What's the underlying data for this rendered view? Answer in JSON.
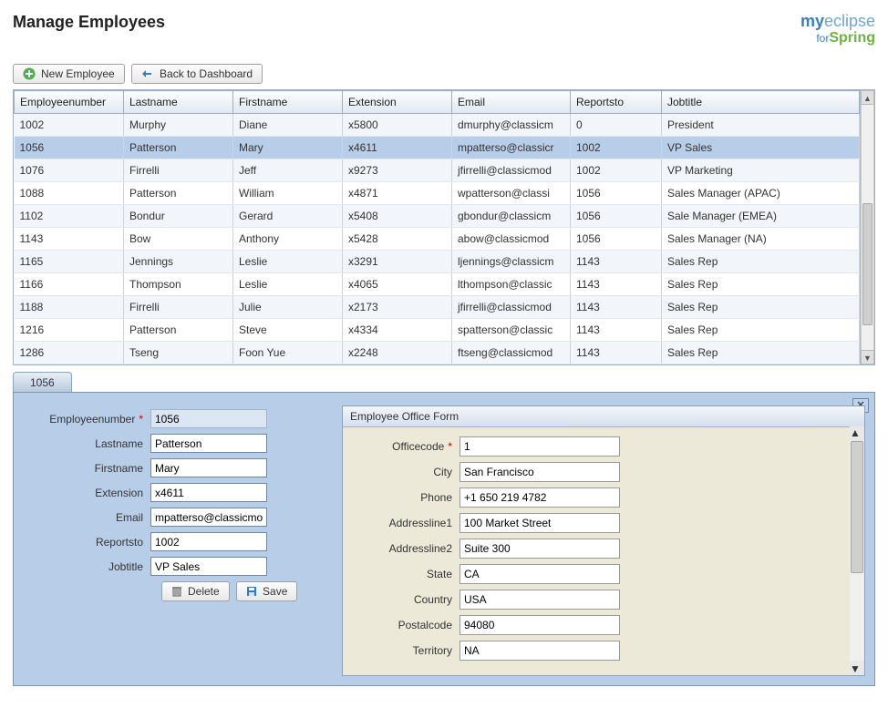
{
  "page": {
    "title": "Manage Employees"
  },
  "toolbar": {
    "new_label": "New Employee",
    "back_label": "Back to Dashboard"
  },
  "grid": {
    "columns": [
      "Employeenumber",
      "Lastname",
      "Firstname",
      "Extension",
      "Email",
      "Reportsto",
      "Jobtitle"
    ],
    "rows": [
      {
        "num": "1002",
        "last": "Murphy",
        "first": "Diane",
        "ext": "x5800",
        "email": "dmurphy@classicm",
        "reports": "0",
        "title": "President"
      },
      {
        "num": "1056",
        "last": "Patterson",
        "first": "Mary",
        "ext": "x4611",
        "email": "mpatterso@classicr",
        "reports": "1002",
        "title": "VP Sales"
      },
      {
        "num": "1076",
        "last": "Firrelli",
        "first": "Jeff",
        "ext": "x9273",
        "email": "jfirrelli@classicmod",
        "reports": "1002",
        "title": "VP Marketing"
      },
      {
        "num": "1088",
        "last": "Patterson",
        "first": "William",
        "ext": "x4871",
        "email": "wpatterson@classi",
        "reports": "1056",
        "title": "Sales Manager (APAC)"
      },
      {
        "num": "1102",
        "last": "Bondur",
        "first": "Gerard",
        "ext": "x5408",
        "email": "gbondur@classicm",
        "reports": "1056",
        "title": "Sale Manager (EMEA)"
      },
      {
        "num": "1143",
        "last": "Bow",
        "first": "Anthony",
        "ext": "x5428",
        "email": "abow@classicmod",
        "reports": "1056",
        "title": "Sales Manager (NA)"
      },
      {
        "num": "1165",
        "last": "Jennings",
        "first": "Leslie",
        "ext": "x3291",
        "email": "ljennings@classicm",
        "reports": "1143",
        "title": "Sales Rep"
      },
      {
        "num": "1166",
        "last": "Thompson",
        "first": "Leslie",
        "ext": "x4065",
        "email": "lthompson@classic",
        "reports": "1143",
        "title": "Sales Rep"
      },
      {
        "num": "1188",
        "last": "Firrelli",
        "first": "Julie",
        "ext": "x2173",
        "email": "jfirrelli@classicmod",
        "reports": "1143",
        "title": "Sales Rep"
      },
      {
        "num": "1216",
        "last": "Patterson",
        "first": "Steve",
        "ext": "x4334",
        "email": "spatterson@classic",
        "reports": "1143",
        "title": "Sales Rep"
      },
      {
        "num": "1286",
        "last": "Tseng",
        "first": "Foon Yue",
        "ext": "x2248",
        "email": "ftseng@classicmod",
        "reports": "1143",
        "title": "Sales Rep"
      }
    ],
    "selected_index": 1
  },
  "tab": {
    "label": "1056"
  },
  "form": {
    "labels": {
      "employeenumber": "Employeenumber",
      "lastname": "Lastname",
      "firstname": "Firstname",
      "extension": "Extension",
      "email": "Email",
      "reportsto": "Reportsto",
      "jobtitle": "Jobtitle"
    },
    "values": {
      "employeenumber": "1056",
      "lastname": "Patterson",
      "firstname": "Mary",
      "extension": "x4611",
      "email": "mpatterso@classicmo",
      "reportsto": "1002",
      "jobtitle": "VP Sales"
    },
    "buttons": {
      "delete": "Delete",
      "save": "Save"
    }
  },
  "office": {
    "title": "Employee Office Form",
    "labels": {
      "officecode": "Officecode",
      "city": "City",
      "phone": "Phone",
      "addressline1": "Addressline1",
      "addressline2": "Addressline2",
      "state": "State",
      "country": "Country",
      "postalcode": "Postalcode",
      "territory": "Territory"
    },
    "values": {
      "officecode": "1",
      "city": "San Francisco",
      "phone": "+1 650 219 4782",
      "addressline1": "100 Market Street",
      "addressline2": "Suite 300",
      "state": "CA",
      "country": "USA",
      "postalcode": "94080",
      "territory": "NA"
    }
  }
}
